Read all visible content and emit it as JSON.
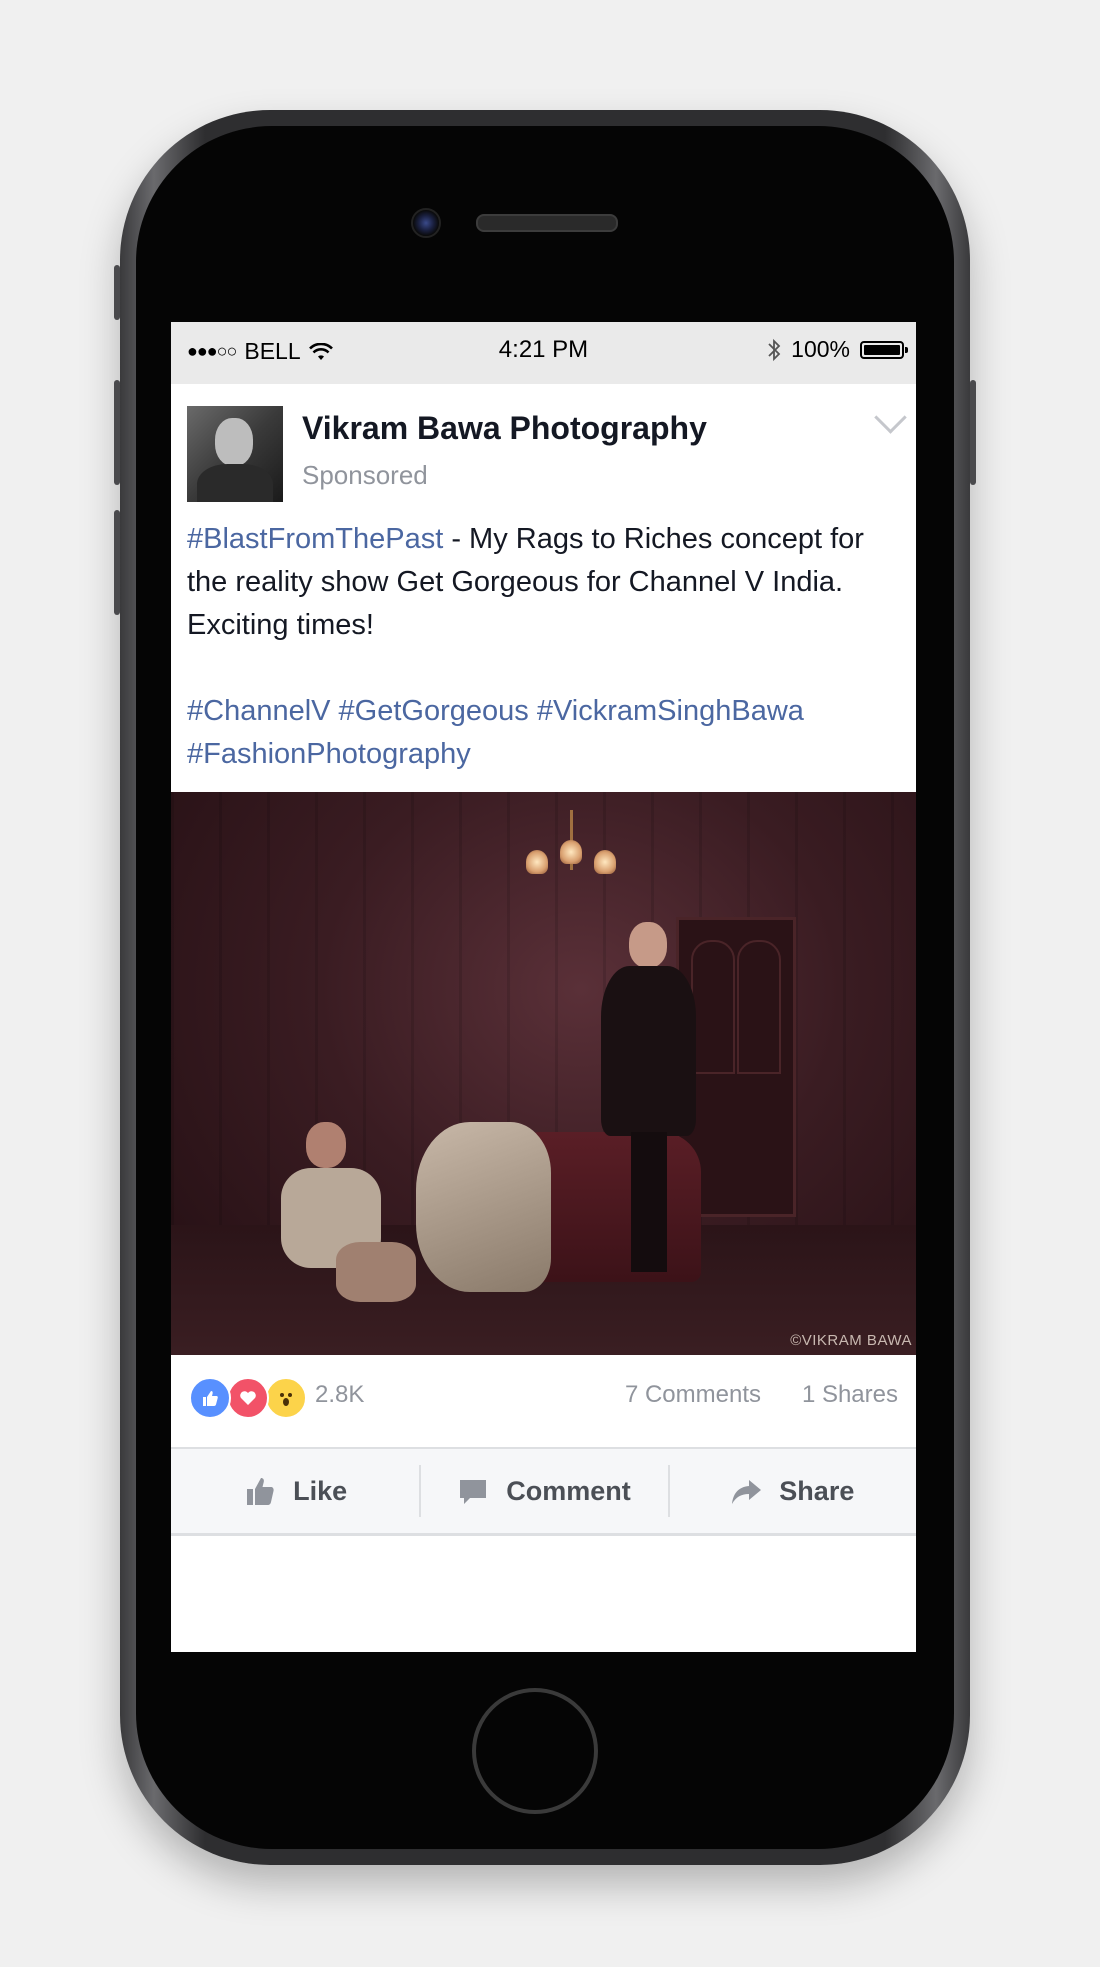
{
  "status_bar": {
    "carrier": "BELL",
    "signal": "●●●○○",
    "time": "4:21 PM",
    "battery_percent": "100%",
    "battery_level": 1.0
  },
  "post": {
    "page_name": "Vikram Bawa Photography",
    "sponsored_label": "Sponsored",
    "text": {
      "hashtag_lead": "#BlastFromThePast",
      "body": " - My Rags to Riches concept for the reality show Get Gorgeous for Channel V India. Exciting times!",
      "hashtags_line1": "#ChannelV #GetGorgeous #VickramSinghBawa",
      "hashtags_line2": "#FashionPhotography"
    },
    "photo_watermark": "©VIKRAM BAWA"
  },
  "engagement": {
    "reactions": [
      "like-icon",
      "love-icon",
      "wow-icon"
    ],
    "reaction_count": "2.8K",
    "comments": "7 Comments",
    "shares": "1 Shares"
  },
  "actions": {
    "like_label": "Like",
    "comment_label": "Comment",
    "share_label": "Share"
  },
  "colors": {
    "hashtag": "#4b67a1",
    "like_reaction": "#5890ff",
    "love_reaction": "#f25268",
    "wow_reaction": "#fcd34a"
  }
}
